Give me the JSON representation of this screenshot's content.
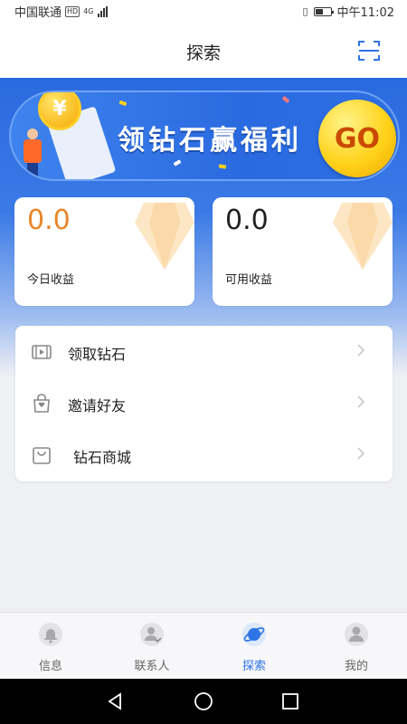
{
  "status_bar": {
    "carrier": "中国联通",
    "network_badge": "HD",
    "network_type": "4G",
    "time": "中午11:02"
  },
  "header": {
    "title": "探索",
    "scan_icon": "scan-icon"
  },
  "banner": {
    "text": "领钻石赢福利",
    "go_label": "GO",
    "coin_symbol": "¥"
  },
  "cards": [
    {
      "value": "0.0",
      "label": "今日收益",
      "value_color": "#e8862a"
    },
    {
      "value": "0.0",
      "label": "可用收益",
      "value_color": "#222222"
    }
  ],
  "menu": {
    "items": [
      {
        "label": "领取钻石",
        "icon": "video-icon"
      },
      {
        "label": "邀请好友",
        "icon": "gift-bag-icon"
      },
      {
        "label": "钻石商城",
        "icon": "shopping-bag-icon"
      }
    ]
  },
  "tabbar": {
    "tabs": [
      {
        "label": "信息",
        "icon": "bell-icon",
        "active": false
      },
      {
        "label": "联系人",
        "icon": "contacts-icon",
        "active": false
      },
      {
        "label": "探索",
        "icon": "planet-icon",
        "active": true
      },
      {
        "label": "我的",
        "icon": "profile-icon",
        "active": false
      }
    ]
  },
  "colors": {
    "accent": "#2f74e6",
    "banner_blue": "#2a6ae0",
    "gold": "#ffd21a",
    "orange_value": "#e8862a"
  }
}
